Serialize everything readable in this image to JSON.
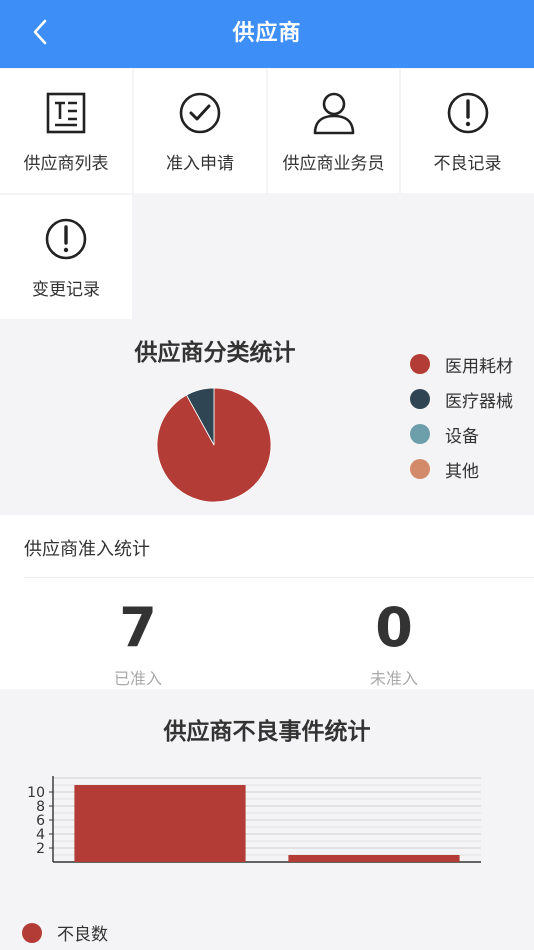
{
  "header": {
    "title": "供应商",
    "back_icon": "chevron-left-icon"
  },
  "menu": {
    "items": [
      {
        "label": "供应商列表",
        "icon": "document-list-icon"
      },
      {
        "label": "准入申请",
        "icon": "check-circle-icon"
      },
      {
        "label": "供应商业务员",
        "icon": "user-icon"
      },
      {
        "label": "不良记录",
        "icon": "exclamation-circle-icon"
      },
      {
        "label": "变更记录",
        "icon": "exclamation-circle-icon"
      }
    ]
  },
  "category_chart": {
    "title": "供应商分类统计",
    "chart_data": {
      "type": "pie",
      "title": "供应商分类统计",
      "categories": [
        "医用耗材",
        "医疗器械",
        "设备",
        "其他"
      ],
      "values": [
        92,
        8,
        0,
        0
      ],
      "colors": [
        "#b43c36",
        "#2f4554",
        "#6d9fab",
        "#d28a6b"
      ],
      "legend": "right"
    }
  },
  "admission": {
    "title": "供应商准入统计",
    "admitted": {
      "value": "7",
      "label": "已准入"
    },
    "not_admitted": {
      "value": "0",
      "label": "未准入"
    }
  },
  "bad_events_chart": {
    "title": "供应商不良事件统计",
    "chart_data": {
      "type": "bar",
      "title": "供应商不良事件统计",
      "categories": [
        "",
        ""
      ],
      "series": [
        {
          "name": "不良数",
          "values": [
            11,
            1
          ]
        }
      ],
      "color": "#b43c36",
      "yticks": [
        "2",
        "4",
        "6",
        "8",
        "10"
      ],
      "ylim": [
        0,
        12
      ],
      "grid": true,
      "legend": "bottom-left"
    }
  }
}
